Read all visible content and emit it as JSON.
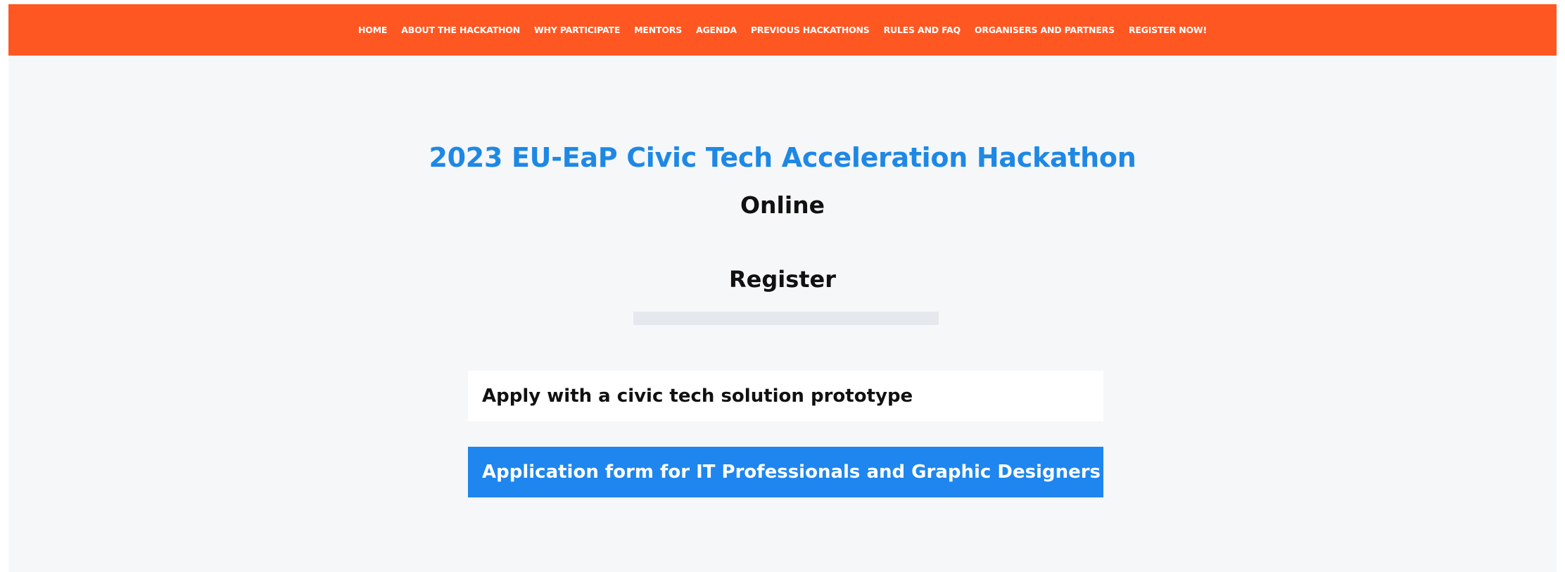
{
  "nav": {
    "items": [
      {
        "label": "HOME"
      },
      {
        "label": "ABOUT THE HACKATHON"
      },
      {
        "label": "WHY PARTICIPATE"
      },
      {
        "label": "MENTORS"
      },
      {
        "label": "AGENDA"
      },
      {
        "label": "PREVIOUS HACKATHONS"
      },
      {
        "label": "RULES AND FAQ"
      },
      {
        "label": "ORGANISERS AND PARTNERS"
      },
      {
        "label": "REGISTER NOW!"
      }
    ]
  },
  "hero": {
    "title": "2023 EU-EaP Civic Tech Acceleration Hackathon",
    "subtitle": "Online"
  },
  "register": {
    "heading": "Register",
    "options": [
      {
        "label": "Apply with a civic tech solution prototype"
      },
      {
        "label": "Application form for IT Professionals and Graphic Designers"
      }
    ]
  },
  "colors": {
    "nav_background": "#ff5722",
    "title_blue": "#1e88e5",
    "button_blue": "#1e86ee",
    "page_background": "#f6f7f8"
  }
}
